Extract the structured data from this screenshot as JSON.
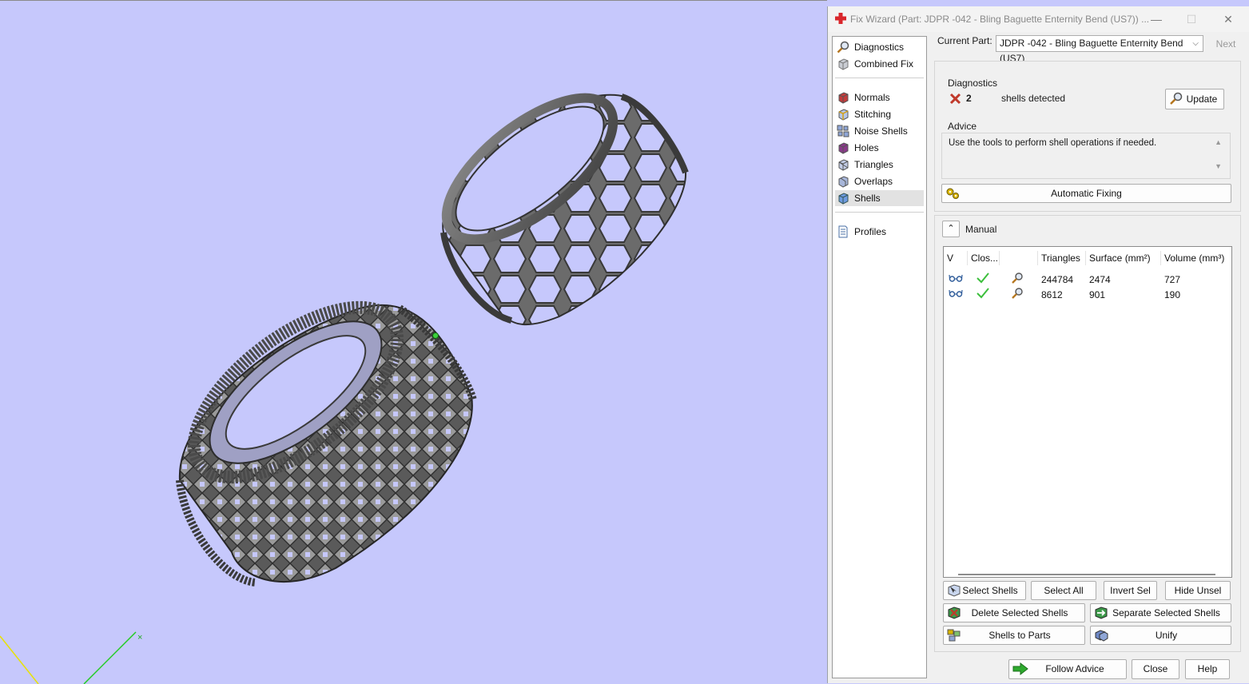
{
  "window": {
    "title": "Fix Wizard (Part: JDPR -042 - Bling Baguette Enternity Bend (US7)) ...",
    "minimize": "—",
    "maximize": "☐",
    "close": "✕"
  },
  "nav": {
    "items": [
      {
        "label": "Diagnostics",
        "icon": "magnifier-icon"
      },
      {
        "label": "Combined Fix",
        "icon": "cube-icon"
      },
      {
        "label": "Normals",
        "icon": "normals-icon"
      },
      {
        "label": "Stitching",
        "icon": "stitching-icon"
      },
      {
        "label": "Noise Shells",
        "icon": "noise-shells-icon"
      },
      {
        "label": "Holes",
        "icon": "holes-icon"
      },
      {
        "label": "Triangles",
        "icon": "triangles-icon"
      },
      {
        "label": "Overlaps",
        "icon": "overlaps-icon"
      },
      {
        "label": "Shells",
        "icon": "shells-icon",
        "selected": true
      },
      {
        "label": "Profiles",
        "icon": "document-icon"
      }
    ]
  },
  "header": {
    "current_part_label": "Current Part:",
    "current_part_value": "JDPR -042 - Bling Baguette Enternity Bend (US7)",
    "next_label": "Next"
  },
  "diagnostics": {
    "title": "Diagnostics",
    "count": "2",
    "message": "shells detected",
    "update_label": "Update"
  },
  "advice": {
    "title": "Advice",
    "text": "Use the tools to perform shell operations if needed.",
    "automatic_fixing_label": "Automatic Fixing"
  },
  "manual": {
    "title": "Manual",
    "columns": [
      "V",
      "Clos...",
      "",
      "Triangles",
      "Surface (mm²)",
      "Volume (mm³)"
    ],
    "rows": [
      {
        "triangles": "244784",
        "surface": "2474",
        "volume": "727"
      },
      {
        "triangles": "8612",
        "surface": "901",
        "volume": "190"
      }
    ]
  },
  "actions": {
    "select_shells": "Select Shells",
    "select_all": "Select All",
    "invert_sel": "Invert Sel",
    "hide_unsel": "Hide Unsel",
    "delete_selected": "Delete Selected Shells",
    "separate_selected": "Separate Selected Shells",
    "shells_to_parts": "Shells to Parts",
    "unify": "Unify"
  },
  "footer": {
    "follow_advice": "Follow Advice",
    "close": "Close",
    "help": "Help"
  },
  "colors": {
    "viewport_bg": "#c6c8fc",
    "dialog_bg": "#f0f0f0",
    "error_red": "#c0392b",
    "check_green": "#3cbf3c",
    "arrow_green": "#2eaa2e"
  }
}
